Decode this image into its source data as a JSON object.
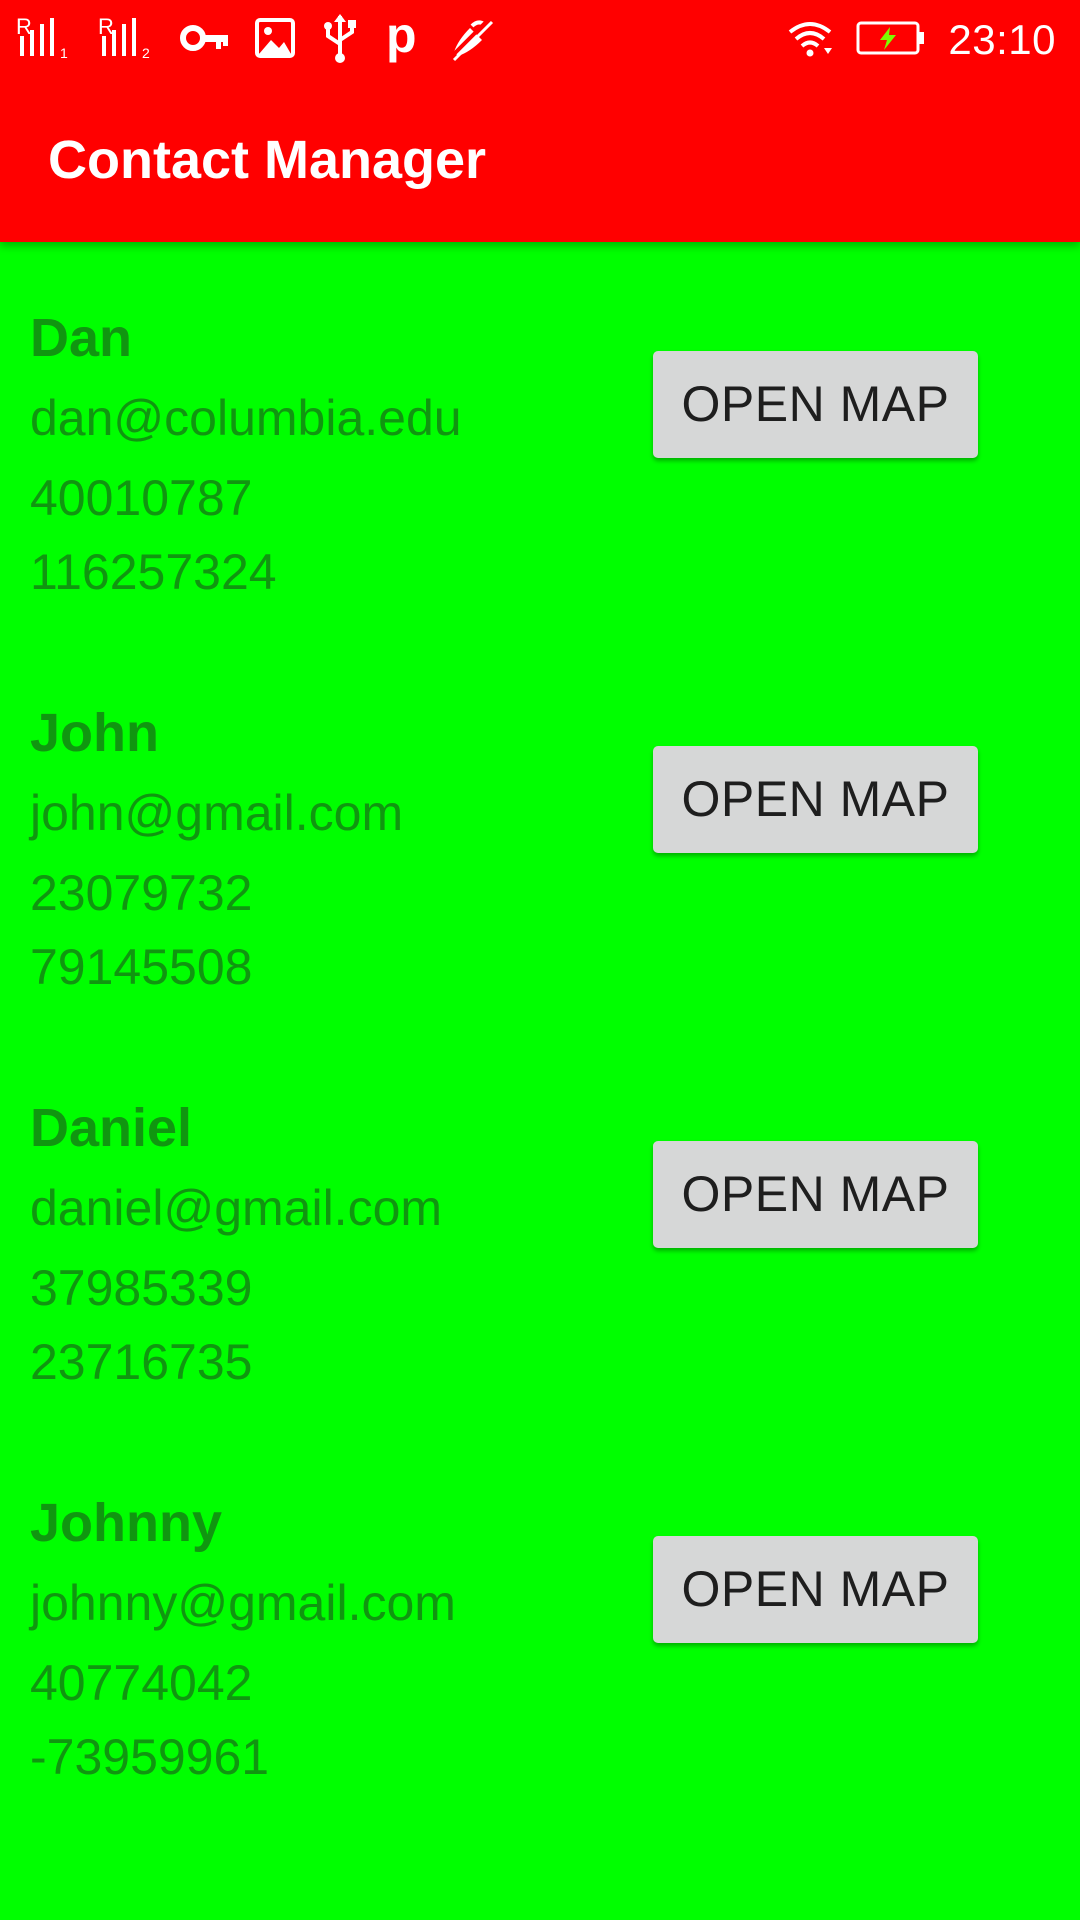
{
  "status_bar": {
    "time": "23:10",
    "icons": [
      "signal-1-icon",
      "signal-2-icon",
      "vpn-key-icon",
      "image-icon",
      "usb-icon",
      "parking-icon",
      "mute-icon",
      "wifi-icon",
      "battery-charging-icon"
    ],
    "signal_1_label": "R",
    "signal_1_sub": "1",
    "signal_2_label": "R",
    "signal_2_sub": "2",
    "p_label": "p"
  },
  "app_bar": {
    "title": "Contact Manager",
    "color": "#ff0000"
  },
  "colors": {
    "background": "#00ff00",
    "text": "#109610",
    "button_bg": "#d6d7d7"
  },
  "contacts": [
    {
      "name": "Dan",
      "email": "dan@columbia.edu",
      "latitude": "40010787",
      "longitude": "116257324",
      "button_label": "OPEN MAP"
    },
    {
      "name": "John",
      "email": "john@gmail.com",
      "latitude": "23079732",
      "longitude": "79145508",
      "button_label": "OPEN MAP"
    },
    {
      "name": "Daniel",
      "email": "daniel@gmail.com",
      "latitude": "37985339",
      "longitude": "23716735",
      "button_label": "OPEN MAP"
    },
    {
      "name": "Johnny",
      "email": "johnny@gmail.com",
      "latitude": "40774042",
      "longitude": "-73959961",
      "button_label": "OPEN MAP"
    }
  ]
}
